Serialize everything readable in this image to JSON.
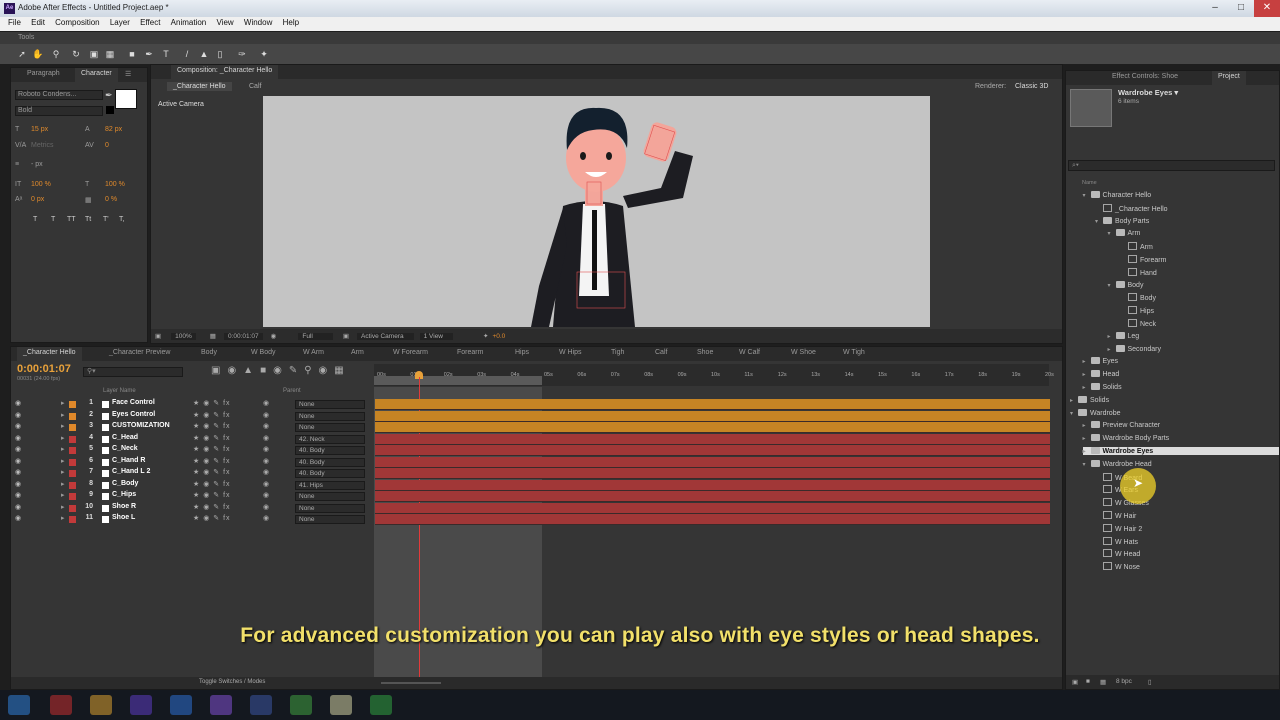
{
  "window": {
    "title": "Adobe After Effects - Untitled Project.aep *",
    "app_icon": "Ae"
  },
  "menu": [
    "File",
    "Edit",
    "Composition",
    "Layer",
    "Effect",
    "Animation",
    "View",
    "Window",
    "Help"
  ],
  "tools_label": "Tools",
  "character_panel": {
    "tabs": [
      "Paragraph",
      "Character"
    ],
    "font": "Roboto Condens...",
    "style": "Bold",
    "size": "15 px",
    "leading": "82 px",
    "kerning": "Metrics",
    "tracking": "0",
    "stroke": "- px",
    "vscale": "100 %",
    "hscale": "100 %",
    "baseline": "0 px",
    "tsume": "0 %",
    "styles": [
      "T",
      "T",
      "TT",
      "Tt",
      "T'",
      "T,"
    ]
  },
  "comp_panel": {
    "tab": "Composition: _Character Hello",
    "breadcrumbs": [
      "_Character Hello",
      "Calf"
    ],
    "renderer_label": "Renderer:",
    "renderer": "Classic 3D",
    "camera_label": "Active Camera",
    "zoom": "100%",
    "timecode": "0:00:01:07",
    "resolution": "Full",
    "camera": "Active Camera",
    "view": "1 View",
    "exposure": "+0.0"
  },
  "timeline": {
    "tabs": [
      "_Character Hello",
      "_Character Preview",
      "Body",
      "W Body",
      "W Arm",
      "Arm",
      "W Forearm",
      "Forearm",
      "Hips",
      "W Hips",
      "Tigh",
      "Calf",
      "Shoe",
      "W Calf",
      "W Shoe",
      "W Tigh"
    ],
    "timecode": "0:00:01:07",
    "frame_info": "00031 (24.00 fps)",
    "col_layer_name": "Layer Name",
    "col_parent": "Parent",
    "ruler": [
      "00s",
      "01s",
      "02s",
      "03s",
      "04s",
      "05s",
      "06s",
      "07s",
      "08s",
      "09s",
      "10s",
      "11s",
      "12s",
      "13s",
      "14s",
      "15s",
      "16s",
      "17s",
      "18s",
      "19s",
      "20s"
    ],
    "layers": [
      {
        "num": "1",
        "name": "Face Control",
        "parent": "None",
        "color": "#e0892a"
      },
      {
        "num": "2",
        "name": "Eyes Control",
        "parent": "None",
        "color": "#e0892a"
      },
      {
        "num": "3",
        "name": "CUSTOMIZATION",
        "parent": "None",
        "color": "#e0892a"
      },
      {
        "num": "4",
        "name": "C_Head",
        "parent": "42. Neck",
        "color": "#c23a3a"
      },
      {
        "num": "5",
        "name": "C_Neck",
        "parent": "40. Body",
        "color": "#c23a3a"
      },
      {
        "num": "6",
        "name": "C_Hand R",
        "parent": "40. Body",
        "color": "#c23a3a"
      },
      {
        "num": "7",
        "name": "C_Hand L 2",
        "parent": "40. Body",
        "color": "#c23a3a"
      },
      {
        "num": "8",
        "name": "C_Body",
        "parent": "41. Hips",
        "color": "#c23a3a"
      },
      {
        "num": "9",
        "name": "C_Hips",
        "parent": "None",
        "color": "#c23a3a"
      },
      {
        "num": "10",
        "name": "Shoe R",
        "parent": "None",
        "color": "#c23a3a"
      },
      {
        "num": "11",
        "name": "Shoe L",
        "parent": "None",
        "color": "#c23a3a"
      }
    ],
    "toggle_label": "Toggle Switches / Modes"
  },
  "project_panel": {
    "tabs": [
      "Effect Controls: Shoe",
      "Project"
    ],
    "selected_name": "Wardrobe Eyes ▾",
    "selected_info": "6 items",
    "search_placeholder": "⌕▾",
    "col_name": "Name",
    "items": [
      {
        "label": "Character Hello",
        "kind": "folder",
        "depth": 0,
        "open": true
      },
      {
        "label": "_Character Hello",
        "kind": "comp",
        "depth": 1
      },
      {
        "label": "Body Parts",
        "kind": "folder",
        "depth": 1,
        "open": true
      },
      {
        "label": "Arm",
        "kind": "folder",
        "depth": 2,
        "open": true
      },
      {
        "label": "Arm",
        "kind": "comp",
        "depth": 3
      },
      {
        "label": "Forearm",
        "kind": "comp",
        "depth": 3
      },
      {
        "label": "Hand",
        "kind": "comp",
        "depth": 3
      },
      {
        "label": "Body",
        "kind": "folder",
        "depth": 2,
        "open": true
      },
      {
        "label": "Body",
        "kind": "comp",
        "depth": 3
      },
      {
        "label": "Hips",
        "kind": "comp",
        "depth": 3
      },
      {
        "label": "Neck",
        "kind": "comp",
        "depth": 3
      },
      {
        "label": "Leg",
        "kind": "folder",
        "depth": 2,
        "open": false
      },
      {
        "label": "Secondary",
        "kind": "folder",
        "depth": 2,
        "open": false
      },
      {
        "label": "Eyes",
        "kind": "folder",
        "depth": 0,
        "open": false
      },
      {
        "label": "Head",
        "kind": "folder",
        "depth": 0,
        "open": false
      },
      {
        "label": "Solids",
        "kind": "folder",
        "depth": 0,
        "open": false
      },
      {
        "label": "Solids",
        "kind": "folder",
        "depth": -1,
        "open": false
      },
      {
        "label": "Wardrobe",
        "kind": "folder",
        "depth": -1,
        "open": true
      },
      {
        "label": "Preview Character",
        "kind": "folder",
        "depth": 0,
        "open": false
      },
      {
        "label": "Wardrobe Body Parts",
        "kind": "folder",
        "depth": 0,
        "open": false
      },
      {
        "label": "Wardrobe Eyes",
        "kind": "folder",
        "depth": 0,
        "open": false,
        "selected": true
      },
      {
        "label": "Wardrobe Head",
        "kind": "folder",
        "depth": 0,
        "open": true
      },
      {
        "label": "W Beard",
        "kind": "comp",
        "depth": 1
      },
      {
        "label": "W Ears",
        "kind": "comp",
        "depth": 1
      },
      {
        "label": "W Glasses",
        "kind": "comp",
        "depth": 1
      },
      {
        "label": "W Hair",
        "kind": "comp",
        "depth": 1
      },
      {
        "label": "W Hair 2",
        "kind": "comp",
        "depth": 1
      },
      {
        "label": "W Hats",
        "kind": "comp",
        "depth": 1
      },
      {
        "label": "W Head",
        "kind": "comp",
        "depth": 1
      },
      {
        "label": "W Nose",
        "kind": "comp",
        "depth": 1
      }
    ],
    "bpc": "8 bpc"
  },
  "subtitle": "For advanced customization you can play also with eye styles or head shapes."
}
